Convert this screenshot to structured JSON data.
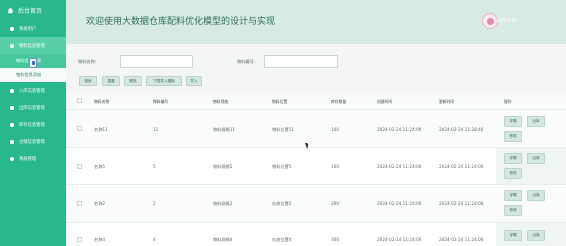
{
  "sidebar": {
    "title": "后台首页",
    "items": [
      {
        "label": "系统用户"
      },
      {
        "label": "物料信息管理"
      },
      {
        "label": "入库信息管理"
      },
      {
        "label": "出库信息管理"
      },
      {
        "label": "库存信息管理"
      },
      {
        "label": "仓储信息管理"
      },
      {
        "label": "系统管理"
      }
    ],
    "subitems": [
      {
        "label": "物料信息列表"
      },
      {
        "label": "物料信息添加"
      }
    ]
  },
  "header": {
    "title": "欢迎使用大数据仓库配料优化模型的设计与实现",
    "user": "admin"
  },
  "search": {
    "name_label": "物料名称:",
    "code_label": "物料编号:"
  },
  "toolbar": {
    "buttons": [
      "搜索",
      "重置",
      "删除",
      "下载导入模板",
      "导入"
    ]
  },
  "table": {
    "headers": [
      "物料名称",
      "物料编号",
      "物料规格",
      "物料位置",
      "库存数量",
      "创建时间",
      "更新时间",
      "操作"
    ],
    "rows": [
      {
        "name": "名称11",
        "code": "11",
        "spec": "物料规格11",
        "loc": "物料位置11",
        "qty": "140",
        "created": "2024-02-24 11:24:06",
        "updated": "2024-02-24 11:28:46"
      },
      {
        "name": "名称5",
        "code": "5",
        "spec": "物料规格5",
        "loc": "物料位置5",
        "qty": "100",
        "created": "2024-02-24 11:24:06",
        "updated": "2024-02-24 11:24:06"
      },
      {
        "name": "名称2",
        "code": "2",
        "spec": "物料规格2",
        "loc": "存放位置2",
        "qty": "200",
        "created": "2024-02-24 11:24:06",
        "updated": "2024-02-24 11:24:06"
      },
      {
        "name": "名称4",
        "code": "4",
        "spec": "物料规格4",
        "loc": "存放位置4",
        "qty": "300",
        "created": "2024-02-24 11:24:06",
        "updated": "2024-02-24 11:24:06"
      }
    ],
    "ops": [
      "详情",
      "出库",
      "修改"
    ]
  },
  "colors": {
    "sidebar": "#29b78c",
    "header": "#d8ebe3",
    "accent": "#2c6e58"
  },
  "icons": {
    "sidebar_logo": "home-icon",
    "avatar": "user-avatar-icon"
  }
}
